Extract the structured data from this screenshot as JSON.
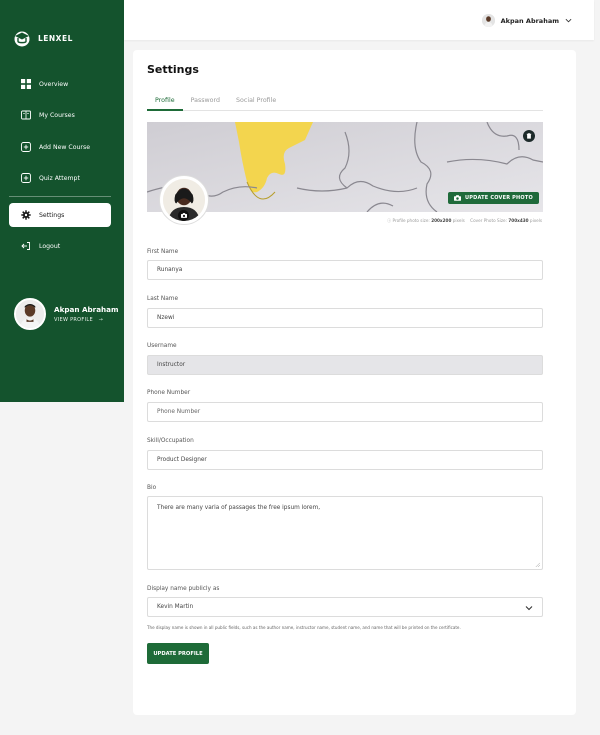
{
  "brand": {
    "name": "LENXEL"
  },
  "sidebar": {
    "items": [
      {
        "label": "Overview",
        "icon": "grid-icon"
      },
      {
        "label": "My Courses",
        "icon": "book-icon"
      },
      {
        "label": "Add New Course",
        "icon": "plus-square-icon"
      },
      {
        "label": "Quiz Attempt",
        "icon": "plus-square-icon"
      },
      {
        "label": "Settings",
        "icon": "gear-icon",
        "active": true
      },
      {
        "label": "Logout",
        "icon": "logout-icon"
      }
    ],
    "profile": {
      "name": "Akpan Abraham",
      "view_label": "VIEW PROFILE",
      "arrow": "→"
    }
  },
  "topbar": {
    "user_name": "Akpan Abraham"
  },
  "settings": {
    "title": "Settings",
    "tabs": [
      "Profile",
      "Password",
      "Social Profile"
    ],
    "cover_button": "UPDATE COVER PHOTO",
    "hint_photo_prefix": "Profile photo size:",
    "hint_photo_size": "200x200",
    "hint_photo_suffix": "pixels",
    "hint_cover_prefix": "Cover Photo Size:",
    "hint_cover_size": "700x430",
    "hint_cover_suffix": "pixels"
  },
  "form": {
    "first_name_label": "First Name",
    "first_name_value": "Runanya",
    "last_name_label": "Last Name",
    "last_name_value": "Nzewi",
    "username_label": "Username",
    "username_value": "Instructor",
    "phone_label": "Phone Number",
    "phone_placeholder": "Phone Number",
    "skill_label": "Skill/Occupation",
    "skill_value": "Product Designer",
    "bio_label": "Bio",
    "bio_value": "There are many varia of passages the free ipsum lorem,",
    "display_label": "Display name publicly as",
    "display_value": "Kevin Martin",
    "display_note": "The display name is shown in all public fields, such as the author name, instructor name, student name, and name that will be printed on the certificate.",
    "submit_label": "UPDATE PROFILE"
  },
  "colors": {
    "brand_green": "#14532d",
    "accent_green": "#1e6b38",
    "puzzle_yellow": "#f3d54e"
  }
}
